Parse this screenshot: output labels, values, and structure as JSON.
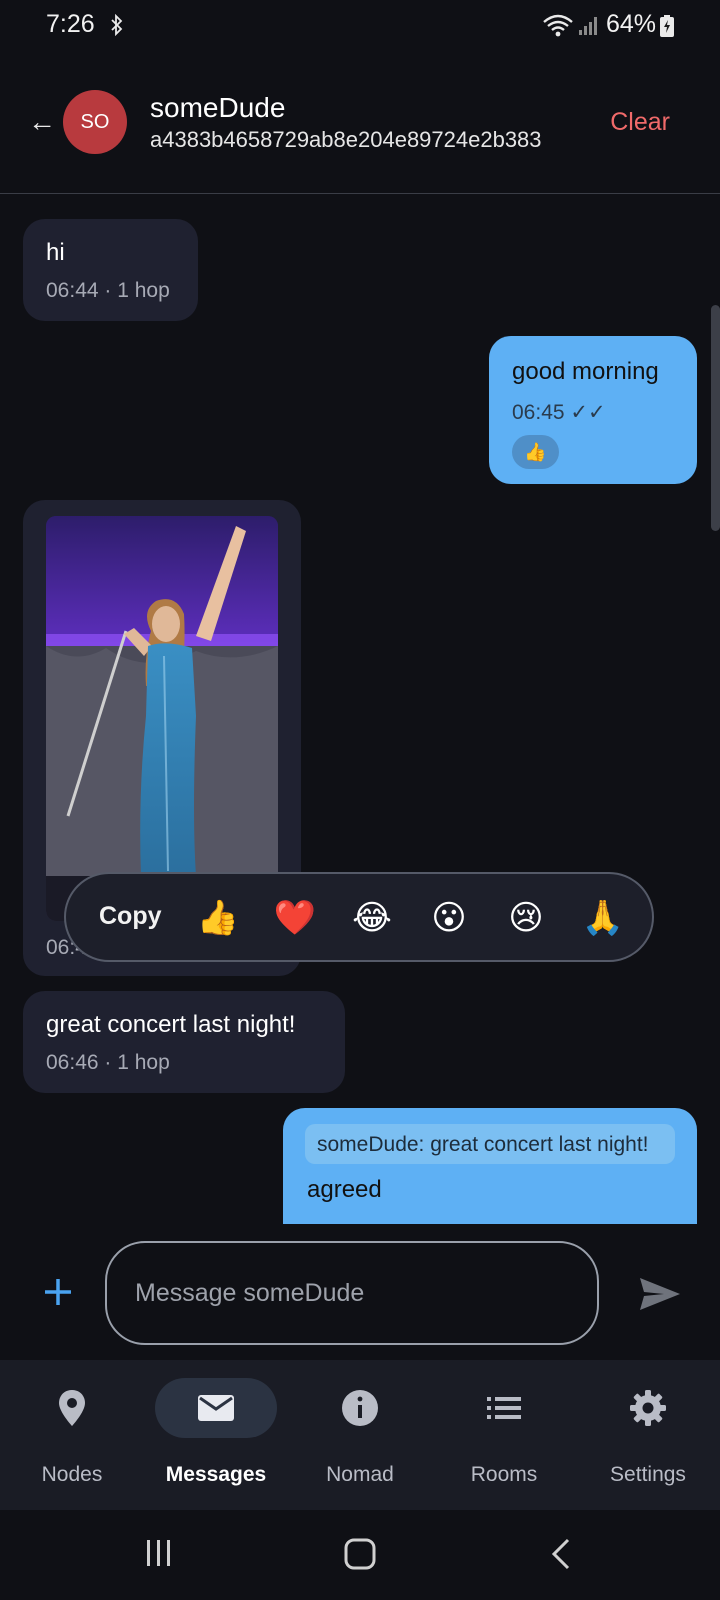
{
  "status_bar": {
    "time": "7:26",
    "battery": "64%"
  },
  "header": {
    "back_glyph": "←",
    "avatar_initials": "SO",
    "contact_name": "someDude",
    "contact_id": "a4383b4658729ab8e204e89724e2b383",
    "clear_label": "Clear",
    "colors": {
      "avatar": "#b83a3e",
      "clear": "#f06a6a"
    }
  },
  "messages": [
    {
      "direction": "incoming",
      "text": "hi",
      "time": "06:44",
      "hops": "· 1 hop"
    },
    {
      "direction": "outgoing",
      "text": "good morning",
      "time": "06:45",
      "status": "✓✓",
      "reaction": "👍"
    },
    {
      "direction": "incoming",
      "type": "image",
      "time": "06:4",
      "image_icon": "concert-photo"
    },
    {
      "direction": "incoming",
      "text": "great concert last night!",
      "time": "06:46",
      "hops": "· 1 hop"
    },
    {
      "direction": "outgoing",
      "quote": "someDude: great concert last night!",
      "text": "agreed"
    }
  ],
  "reaction_menu": {
    "copy_label": "Copy",
    "emojis": [
      "👍",
      "❤️",
      "😂",
      "😮",
      "😢",
      "🙏"
    ]
  },
  "composer": {
    "placeholder": "Message someDude"
  },
  "nav": {
    "items": [
      {
        "label": "Nodes",
        "icon": "location-pin-icon"
      },
      {
        "label": "Messages",
        "icon": "mail-icon",
        "active": true
      },
      {
        "label": "Nomad",
        "icon": "info-icon"
      },
      {
        "label": "Rooms",
        "icon": "list-icon"
      },
      {
        "label": "Settings",
        "icon": "gear-icon"
      }
    ]
  },
  "colors": {
    "background": "#0f1015",
    "incoming_bubble": "#1f2130",
    "outgoing_bubble": "#5eb0f4",
    "accent": "#4aa3f0"
  }
}
